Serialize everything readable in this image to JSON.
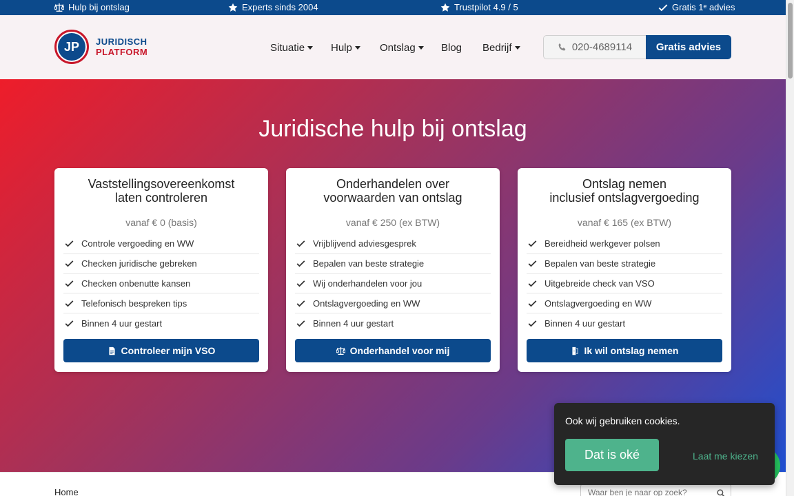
{
  "topbar": {
    "items": [
      {
        "label": "Hulp bij ontslag",
        "icon": "scale-icon"
      },
      {
        "label": "Experts sinds 2004",
        "icon": "star-icon"
      },
      {
        "label": "Trustpilot 4.9 / 5",
        "icon": "star-icon"
      },
      {
        "label": "Gratis 1ᵉ advies",
        "icon": "check-icon"
      }
    ]
  },
  "header": {
    "logo_initials": "JP",
    "logo_line1": "JURIDISCH",
    "logo_line2": "PLATFORM",
    "nav": [
      {
        "label": "Situatie",
        "dropdown": true
      },
      {
        "label": "Hulp",
        "dropdown": true
      },
      {
        "label": "Ontslag",
        "dropdown": true
      },
      {
        "label": "Blog",
        "dropdown": false
      },
      {
        "label": "Bedrijf",
        "dropdown": true
      }
    ],
    "phone": "020-4689114",
    "cta_label": "Gratis advies"
  },
  "hero": {
    "title": "Juridische hulp bij ontslag",
    "cards": [
      {
        "title_line1": "Vaststellingsovereenkomst",
        "title_line2": "laten controleren",
        "price": "vanaf € 0 (basis)",
        "features": [
          "Controle vergoeding en WW",
          "Checken juridische gebreken",
          "Checken onbenutte kansen",
          "Telefonisch bespreken tips",
          "Binnen 4 uur gestart"
        ],
        "button": "Controleer mijn VSO",
        "button_icon": "document-icon"
      },
      {
        "title_line1": "Onderhandelen over",
        "title_line2": "voorwaarden van ontslag",
        "price": "vanaf € 250 (ex BTW)",
        "features": [
          "Vrijblijvend adviesgesprek",
          "Bepalen van beste strategie",
          "Wij onderhandelen voor jou",
          "Ontslagvergoeding en WW",
          "Binnen 4 uur gestart"
        ],
        "button": "Onderhandel voor mij",
        "button_icon": "scale-icon"
      },
      {
        "title_line1": "Ontslag nemen",
        "title_line2": "inclusief ontslagvergoeding",
        "price": "vanaf € 165 (ex BTW)",
        "features": [
          "Bereidheid werkgever polsen",
          "Bepalen van beste strategie",
          "Uitgebreide check van VSO",
          "Ontslagvergoeding en WW",
          "Binnen 4 uur gestart"
        ],
        "button": "Ik wil ontslag nemen",
        "button_icon": "door-exit-icon"
      }
    ]
  },
  "bottom": {
    "breadcrumb": "Home",
    "search_placeholder": "Waar ben je naar op zoek?"
  },
  "cookie": {
    "text": "Ook wij gebruiken cookies.",
    "ok_label": "Dat is oké",
    "choose_label": "Laat me kiezen"
  },
  "colors": {
    "brand_blue": "#0c4a8c",
    "brand_red": "#c8172a",
    "cookie_green": "#4eb38c"
  }
}
